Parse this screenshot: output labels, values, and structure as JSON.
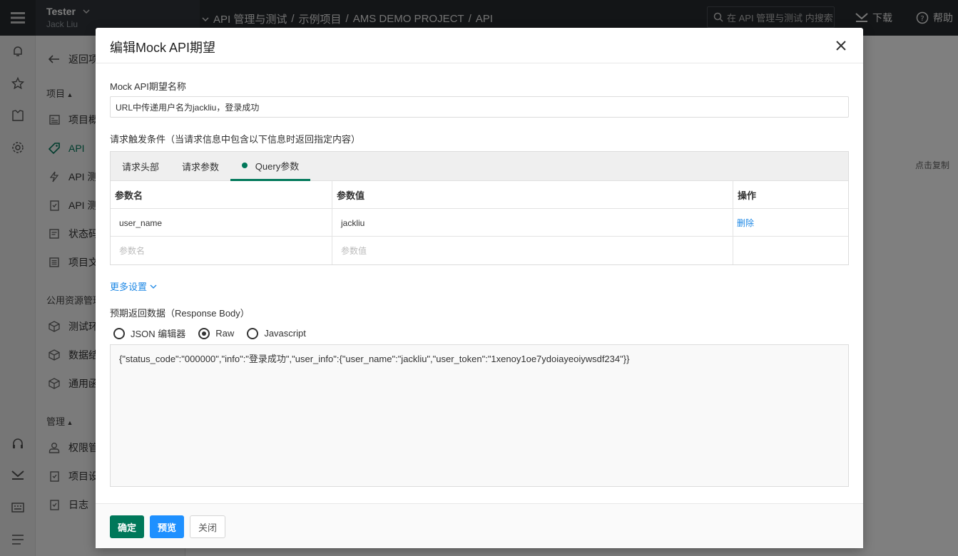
{
  "topbar": {
    "user_name": "Tester",
    "user_sub": "Jack Liu",
    "breadcrumb": [
      "API 管理与测试",
      "/",
      "示例项目",
      "/",
      "AMS DEMO PROJECT",
      "/",
      "API"
    ],
    "search_placeholder": "在 API 管理与测试 内搜索",
    "download_label": "下载",
    "help_label": "帮助"
  },
  "sidebar": {
    "back_label": "返回项",
    "project_head": "项目",
    "items": [
      {
        "label": "项目概",
        "icon": "overview-icon"
      },
      {
        "label": "API",
        "icon": "api-tag-icon"
      },
      {
        "label": "API 测",
        "icon": "lightning-icon"
      },
      {
        "label": "API 测",
        "icon": "checklist-icon"
      },
      {
        "label": "状态码",
        "icon": "status-code-icon"
      },
      {
        "label": "项目文",
        "icon": "document-icon"
      }
    ],
    "resource_head": "公用资源管理",
    "resource_items": [
      {
        "label": "测试环",
        "icon": "cube-icon"
      },
      {
        "label": "数据结",
        "icon": "cube-icon"
      },
      {
        "label": "通用函",
        "icon": "cube-icon"
      }
    ],
    "manage_head": "管理",
    "manage_items": [
      {
        "label": "权限管",
        "icon": "user-icon"
      },
      {
        "label": "项目设",
        "icon": "checklist-icon"
      },
      {
        "label": "日志",
        "icon": "checklist-icon"
      }
    ]
  },
  "background": {
    "copy_label": "点击复制"
  },
  "modal": {
    "title": "编辑Mock API期望",
    "name_label": "Mock API期望名称",
    "name_value": "URL中传递用户名为jackliu，登录成功",
    "condition_label": "请求触发条件（当请求信息中包含以下信息时返回指定内容）",
    "tabs": [
      {
        "label": "请求头部"
      },
      {
        "label": "请求参数"
      },
      {
        "label": "Query参数"
      }
    ],
    "table": {
      "headers": [
        "参数名",
        "参数值",
        "操作"
      ],
      "rows": [
        {
          "name": "user_name",
          "value": "jackliu",
          "action": "删除"
        }
      ],
      "new_row": {
        "name_placeholder": "参数名",
        "value_placeholder": "参数值"
      }
    },
    "more_settings": "更多设置",
    "response_label": "预期返回数据（Response Body）",
    "radios": [
      {
        "label": "JSON 编辑器"
      },
      {
        "label": "Raw"
      },
      {
        "label": "Javascript"
      }
    ],
    "response_body": "{\"status_code\":\"000000\",\"info\":\"登录成功\",\"user_info\":{\"user_name\":\"jackliu\",\"user_token\":\"1xenoy1oe7ydoiayeoiywsdf234\"}}",
    "buttons": {
      "confirm": "确定",
      "preview": "预览",
      "close": "关闭"
    }
  },
  "colors": {
    "brand_green": "#00785a",
    "link_blue": "#1e88e5",
    "preview_blue": "#1e90ff",
    "topbar": "#272b2e"
  }
}
